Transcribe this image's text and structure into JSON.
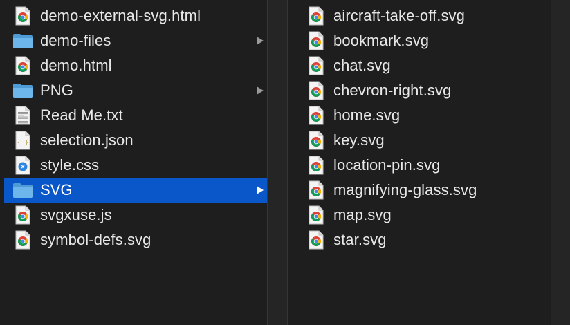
{
  "columns": [
    {
      "items": [
        {
          "label": "demo-external-svg.html",
          "icon": "chrome-file-icon",
          "type": "file"
        },
        {
          "label": "demo-files",
          "icon": "folder-icon",
          "type": "folder"
        },
        {
          "label": "demo.html",
          "icon": "chrome-file-icon",
          "type": "file"
        },
        {
          "label": "PNG",
          "icon": "folder-icon",
          "type": "folder"
        },
        {
          "label": "Read Me.txt",
          "icon": "text-file-icon",
          "type": "file"
        },
        {
          "label": "selection.json",
          "icon": "json-file-icon",
          "type": "file"
        },
        {
          "label": "style.css",
          "icon": "css-file-icon",
          "type": "file"
        },
        {
          "label": "SVG",
          "icon": "folder-icon",
          "type": "folder",
          "selected": true
        },
        {
          "label": "svgxuse.js",
          "icon": "chrome-file-icon",
          "type": "file"
        },
        {
          "label": "symbol-defs.svg",
          "icon": "chrome-file-icon",
          "type": "file"
        }
      ]
    },
    {
      "items": [
        {
          "label": "aircraft-take-off.svg",
          "icon": "chrome-file-icon",
          "type": "file"
        },
        {
          "label": "bookmark.svg",
          "icon": "chrome-file-icon",
          "type": "file"
        },
        {
          "label": "chat.svg",
          "icon": "chrome-file-icon",
          "type": "file"
        },
        {
          "label": "chevron-right.svg",
          "icon": "chrome-file-icon",
          "type": "file"
        },
        {
          "label": "home.svg",
          "icon": "chrome-file-icon",
          "type": "file"
        },
        {
          "label": "key.svg",
          "icon": "chrome-file-icon",
          "type": "file"
        },
        {
          "label": "location-pin.svg",
          "icon": "chrome-file-icon",
          "type": "file"
        },
        {
          "label": "magnifying-glass.svg",
          "icon": "chrome-file-icon",
          "type": "file"
        },
        {
          "label": "map.svg",
          "icon": "chrome-file-icon",
          "type": "file"
        },
        {
          "label": "star.svg",
          "icon": "chrome-file-icon",
          "type": "file"
        }
      ]
    }
  ],
  "colors": {
    "background": "#1e1e1f",
    "selection": "#0a57c9",
    "folder": "#5ba8e0",
    "text": "#e8e8e8"
  }
}
